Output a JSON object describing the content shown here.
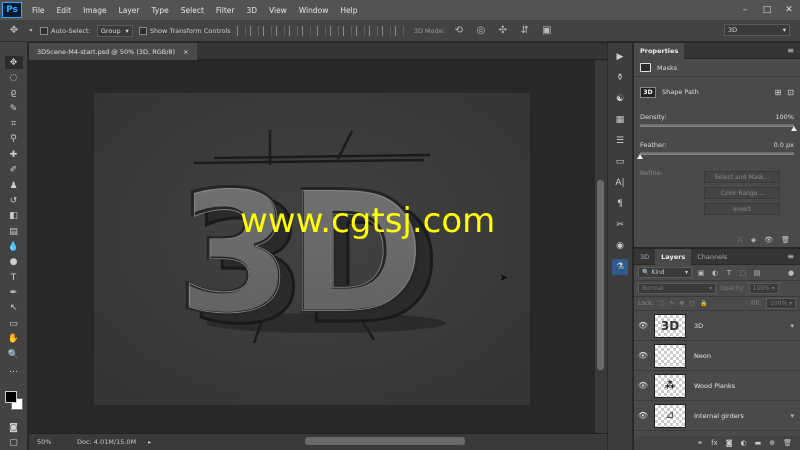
{
  "app": {
    "logo": "Ps"
  },
  "menu": [
    "File",
    "Edit",
    "Image",
    "Layer",
    "Type",
    "Select",
    "Filter",
    "3D",
    "View",
    "Window",
    "Help"
  ],
  "window_controls": [
    "–",
    "□",
    "✕"
  ],
  "options_bar": {
    "auto_select_label": "Auto-Select:",
    "auto_select_value": "Group",
    "transform_controls_label": "Show Transform Controls",
    "mode_3d_label": "3D Mode:",
    "workspace_value": "3D"
  },
  "document": {
    "tab_title": "3DScene-M4-start.psd @ 50% (3D, RGB/8)",
    "tab_close": "×",
    "zoom": "50%",
    "doc_size": "Doc: 4.01M/15.0M",
    "watermark": "www.cgtsj.com"
  },
  "properties": {
    "panel_title": "Properties",
    "masks_label": "Masks",
    "shape_path_label": "Shape Path",
    "shape_icon_text": "3D",
    "density_label": "Density:",
    "density_value": "100%",
    "density_fraction": 1.0,
    "feather_label": "Feather:",
    "feather_value": "0.0 px",
    "feather_fraction": 0.0,
    "refine_label": "Refine:",
    "select_and_mask": "Select and Mask...",
    "color_range": "Color Range...",
    "invert_label": "Invert"
  },
  "layers_panel": {
    "tabs": [
      "3D",
      "Layers",
      "Channels"
    ],
    "active_tab": "Layers",
    "kind_filter": "Kind",
    "blend_mode": "Normal",
    "opacity_label": "Opacity:",
    "opacity_value": "100%",
    "lock_label": "Lock:",
    "fill_label": "Fill:",
    "fill_value": "100%",
    "layers": [
      {
        "name": "3D",
        "thumb_text": "3D"
      },
      {
        "name": "Neon",
        "thumb_text": ""
      },
      {
        "name": "Wood Planks",
        "thumb_text": ""
      },
      {
        "name": "Internal girders",
        "thumb_text": ""
      }
    ]
  },
  "colors": {
    "ui_dark": "#262626",
    "panel": "#4a4a4a",
    "watermark": "#ffff00",
    "accent": "#31a8ff",
    "canvas": "#3a3a3a"
  }
}
